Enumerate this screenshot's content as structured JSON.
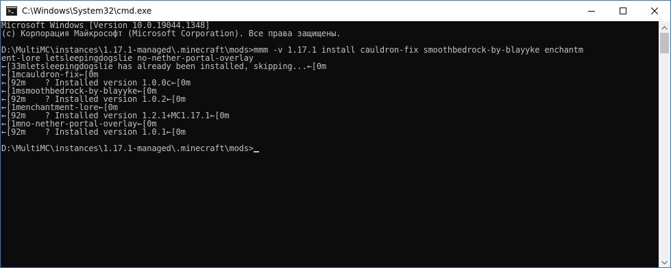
{
  "window": {
    "title": "C:\\Windows\\System32\\cmd.exe",
    "icon": "cmd-icon",
    "controls": [
      "minimize-icon",
      "maximize-icon",
      "close-icon"
    ]
  },
  "console": {
    "lines": [
      "Microsoft Windows [Version 10.0.19044.1348]",
      "(c) Корпорация Майкрософт (Microsoft Corporation). Все права защищены.",
      "",
      "D:\\MultiMC\\instances\\1.17.1-managed\\.minecraft\\mods>mmm -v 1.17.1 install cauldron-fix smoothbedrock-by-blayyke enchantm",
      "ent-lore letsleepingdogslie no-nether-portal-overlay",
      "←[33mletsleepingdogslie has already been installed, skipping...←[0m",
      "←[1mcauldron-fix←[0m",
      "←[92m    ? Installed version 1.0.0c←[0m",
      "←[1msmoothbedrock-by-blayyke←[0m",
      "←[92m    ? Installed version 1.0.2←[0m",
      "←[1menchantment-lore←[0m",
      "←[92m    ? Installed version 1.2.1+MC1.17.1←[0m",
      "←[1mno-nether-portal-overlay←[0m",
      "←[92m    ? Installed version 1.0.1←[0m",
      "",
      "D:\\MultiMC\\instances\\1.17.1-managed\\.minecraft\\mods>"
    ]
  },
  "colors": {
    "console_bg": "#0c0c0c",
    "console_fg": "#c0c0c0",
    "titlebar_bg": "#ffffff",
    "window_border": "#2b78c4",
    "scrollbar_bg": "#f0f0f0",
    "scroll_thumb": "#c1c1c1"
  }
}
